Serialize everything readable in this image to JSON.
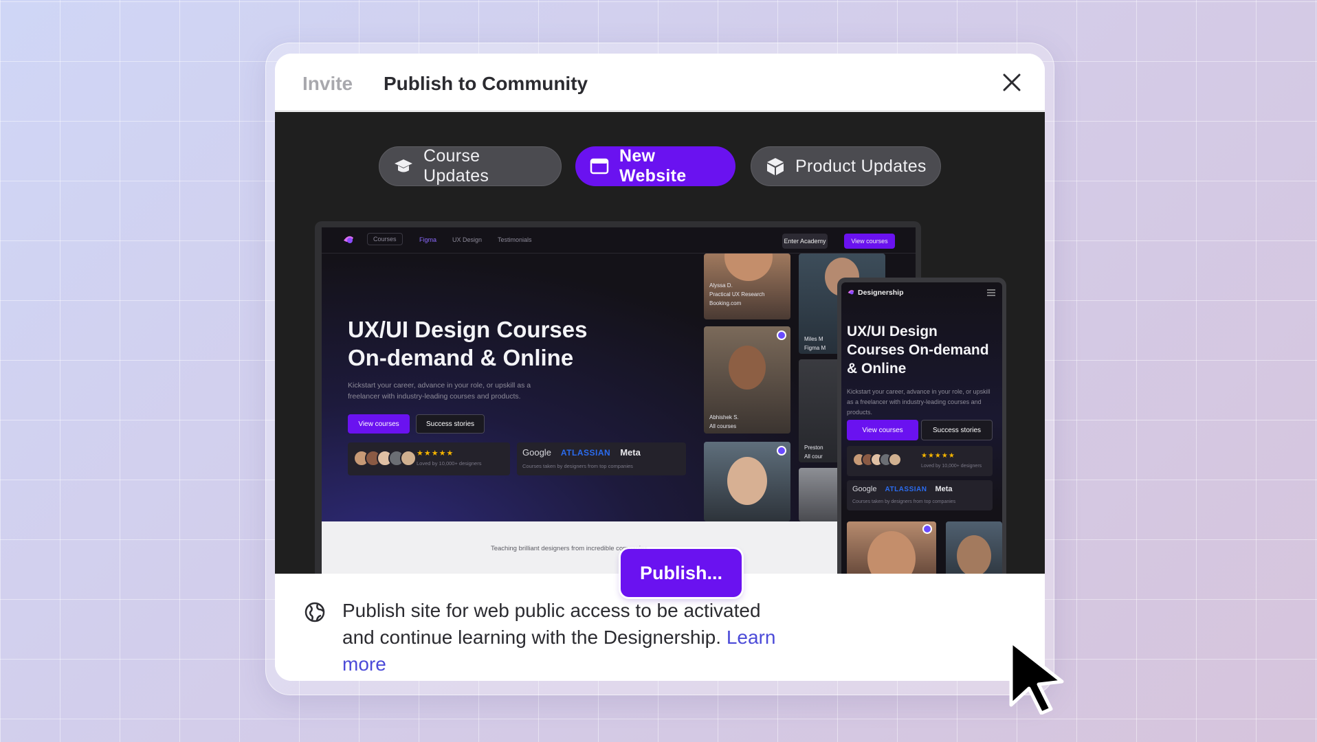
{
  "dialog": {
    "tabs": {
      "invite": "Invite",
      "publish": "Publish to Community"
    }
  },
  "filters": [
    {
      "label": "Course Updates",
      "icon": "graduation-cap-icon",
      "active": false
    },
    {
      "label": "New Website",
      "icon": "browser-window-icon",
      "active": true
    },
    {
      "label": "Product Updates",
      "icon": "box-icon",
      "active": false
    }
  ],
  "preview": {
    "desktop": {
      "nav": [
        "Courses",
        "Figma",
        "UX Design",
        "Testimonials"
      ],
      "enter": "Enter Academy",
      "view": "View courses",
      "heading": "UX/UI Design Courses On-demand & Online",
      "subtitle": "Kickstart your career, advance in your role, or upskill as a freelancer with industry-leading courses and products.",
      "cta_view": "View courses",
      "cta_success": "Success stories",
      "stars": "★★★★★",
      "loved": "Loved by 10,000+ designers",
      "logos": {
        "google": "Google",
        "atlassian": "ATLASSIAN",
        "meta": "Meta"
      },
      "taken": "Courses taken by designers from top companies",
      "footer": "Teaching brilliant designers from incredible companies",
      "people": [
        {
          "name": "Alyssa D.",
          "course": "Practical UX Research",
          "company": "Booking.com"
        },
        {
          "name": "Miles M",
          "course": "Figma M"
        },
        {
          "name": "Abhishek S.",
          "course": "All courses"
        },
        {
          "name": "Preston",
          "course": "All cour"
        }
      ]
    },
    "mobile": {
      "brand": "Designership",
      "heading": "UX/UI Design Courses On-demand & Online",
      "subtitle": "Kickstart your career, advance in your role, or upskill as a freelancer with industry-leading courses and products.",
      "cta_view": "View courses",
      "cta_success": "Success stories",
      "stars": "★★★★★",
      "loved": "Loved by 10,000+ designers",
      "logos": {
        "google": "Google",
        "atlassian": "ATLASSIAN",
        "meta": "Meta"
      },
      "taken": "Courses taken by designers from top companies"
    }
  },
  "footer": {
    "text": "Publish site for web public access to be activated and continue learning with the Designership.",
    "link": "Learn more",
    "button": "Publish..."
  },
  "colors": {
    "accent": "#6a12f0",
    "link": "#4b4ad8",
    "stage": "#1f1f1f"
  }
}
